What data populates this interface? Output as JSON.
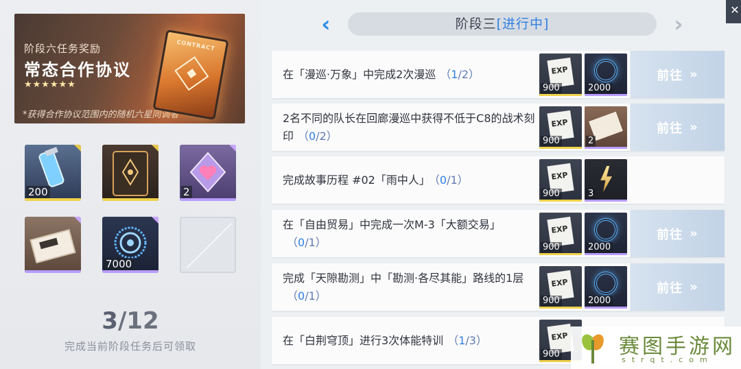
{
  "reward_banner": {
    "subtitle": "阶段六任务奖励",
    "title": "常态合作协议",
    "stars": "★★★★★★",
    "note": "*获得合作协议范围内的随机六星同调者",
    "card_text": "CONTRACT"
  },
  "reward_grid": [
    {
      "icon": "energy-vial-icon",
      "qty": "200",
      "rarity": "yellow"
    },
    {
      "icon": "contract-card-icon",
      "qty": "",
      "rarity": "yellow"
    },
    {
      "icon": "heart-crystal-icon",
      "qty": "2",
      "rarity": "purple"
    },
    {
      "icon": "ticket-bundle-icon",
      "qty": "",
      "rarity": "purple"
    },
    {
      "icon": "coin-icon",
      "qty": "7000",
      "rarity": "purple"
    }
  ],
  "progress": {
    "current": "3",
    "separator": "/",
    "total": "12",
    "note": "完成当前阶段任务后可领取"
  },
  "stage_header": {
    "name": "阶段三",
    "status": "[进行中]",
    "prev_icon": "chevron-left-icon",
    "next_icon": "chevron-right-icon"
  },
  "tasks": [
    {
      "text": "在「漫巡·万象」中完成2次漫巡",
      "progress_open": "（",
      "progress_current": "1",
      "progress_rest": "/2）",
      "rewards": [
        {
          "icon": "exp-icon",
          "qty": "900"
        },
        {
          "icon": "coin-icon",
          "qty": "2000"
        }
      ],
      "button": "前往"
    },
    {
      "text": "2名不同的队长在回廊漫巡中获得不低于C8的战术刻印",
      "progress_open": "（",
      "progress_current": "0",
      "progress_rest": "/2）",
      "rewards": [
        {
          "icon": "exp-icon",
          "qty": "900"
        },
        {
          "icon": "ticket-icon",
          "qty": "2"
        }
      ],
      "button": "前往"
    },
    {
      "text": "完成故事历程 #02「雨中人」",
      "progress_open": "（",
      "progress_current": "0",
      "progress_rest": "/1）",
      "rewards": [
        {
          "icon": "exp-icon",
          "qty": "900"
        },
        {
          "icon": "shard-icon",
          "qty": "3"
        }
      ],
      "button": ""
    },
    {
      "text": "在「自由贸易」中完成一次M-3「大额交易」",
      "progress_open": "（",
      "progress_current": "0",
      "progress_rest": "/1）",
      "rewards": [
        {
          "icon": "exp-icon",
          "qty": "900"
        },
        {
          "icon": "coin-icon",
          "qty": "2000"
        }
      ],
      "button": "前往"
    },
    {
      "text": "完成「天隙勘测」中「勘测·各尽其能」路线的1层",
      "progress_open": "（",
      "progress_current": "0",
      "progress_rest": "/1）",
      "rewards": [
        {
          "icon": "exp-icon",
          "qty": "900"
        },
        {
          "icon": "coin-icon",
          "qty": "2000"
        }
      ],
      "button": "前往"
    },
    {
      "text": "在「白荆穹顶」进行3次体能特训",
      "progress_open": "（",
      "progress_current": "1",
      "progress_rest": "/3）",
      "rewards": [
        {
          "icon": "exp-icon",
          "qty": "900"
        }
      ],
      "button": ""
    }
  ],
  "watermark": {
    "title": "赛图手游网",
    "url": "strqt.com"
  }
}
